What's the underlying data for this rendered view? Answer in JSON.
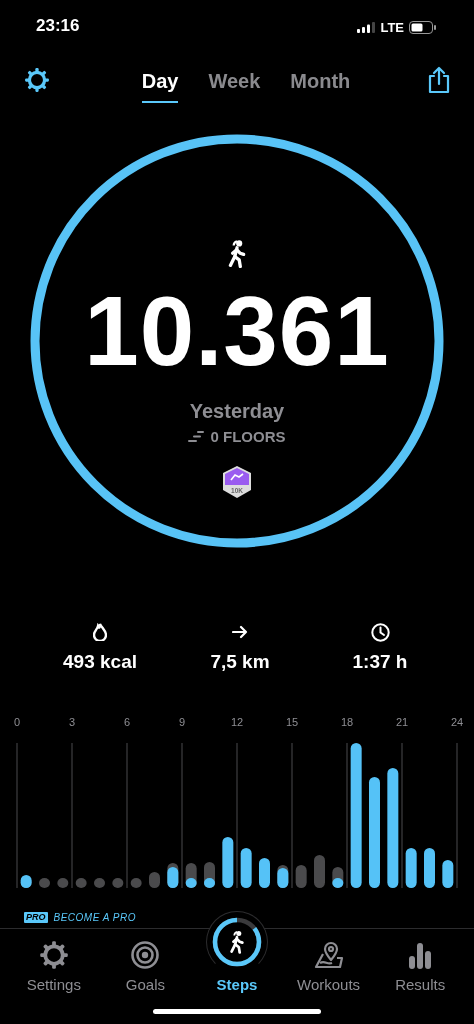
{
  "status_bar": {
    "time": "23:16",
    "network": "LTE"
  },
  "header": {
    "tabs": [
      {
        "label": "Day",
        "selected": true
      },
      {
        "label": "Week",
        "selected": false
      },
      {
        "label": "Month",
        "selected": false
      }
    ]
  },
  "summary": {
    "level": 1,
    "steps": "10.361",
    "day": "Yesterday",
    "floors": "0 FLOORS",
    "badge": "10K"
  },
  "stats": [
    {
      "kind": "calories",
      "value": "493 kcal"
    },
    {
      "kind": "distance",
      "value": "7,5 km"
    },
    {
      "kind": "duration",
      "value": "1:37 h"
    }
  ],
  "hourly_chart": {
    "hour_labels": [
      "0",
      "3",
      "6",
      "9",
      "12",
      "15",
      "18",
      "21",
      "24"
    ]
  },
  "promo": {
    "badge": "PRO",
    "text": "BECOME A PRO"
  },
  "tab_bar": {
    "items": [
      {
        "kind": "settings",
        "label": "Settings",
        "selected": false
      },
      {
        "kind": "goals",
        "label": "Goals",
        "selected": false
      },
      {
        "kind": "steps",
        "label": "Steps",
        "selected": true
      },
      {
        "kind": "workouts",
        "label": "Workouts",
        "selected": false
      },
      {
        "kind": "results",
        "label": "Results",
        "selected": false
      }
    ]
  }
}
